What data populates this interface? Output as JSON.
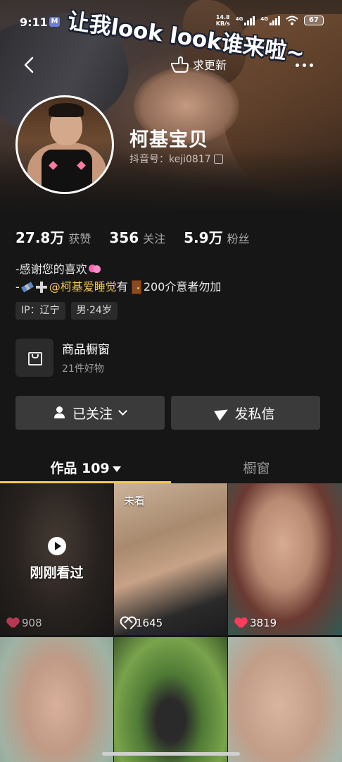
{
  "status_bar": {
    "time": "9:11",
    "app_icon": "M",
    "net_speed_value": "14.8",
    "net_speed_unit": "KB/s",
    "signal1_label": "4G",
    "signal2_label": "4G",
    "battery": "67"
  },
  "header": {
    "cover_caption": "让我look look谁来啦~",
    "update_label": "求更新"
  },
  "profile": {
    "name": "柯基宝贝",
    "douyin_id": "抖音号：keji0817"
  },
  "stats": [
    {
      "value": "27.8万",
      "label": "获赞"
    },
    {
      "value": "356",
      "label": "关注"
    },
    {
      "value": "5.9万",
      "label": "粉丝"
    }
  ],
  "bio": {
    "line1": "-感谢您的喜欢",
    "line2_prefix": "-",
    "mention": "@柯基爱睡觉",
    "line2_mid": " 有",
    "line2_suffix": "200介意者勿加"
  },
  "tags": [
    "IP：辽宁",
    "男·24岁"
  ],
  "shop": {
    "title": "商品橱窗",
    "subtitle": "21件好物"
  },
  "buttons": {
    "follow": "已关注",
    "message": "发私信"
  },
  "tabs": {
    "works": "作品 109",
    "showcase": "橱窗"
  },
  "grid": {
    "watched_label": "刚刚看过",
    "unseen_label": "未看",
    "likes": [
      "908",
      "1645",
      "3819"
    ]
  },
  "colors": {
    "accent_yellow": "#f5c85a",
    "like_red": "#ff3b5c",
    "background": "#161616"
  }
}
